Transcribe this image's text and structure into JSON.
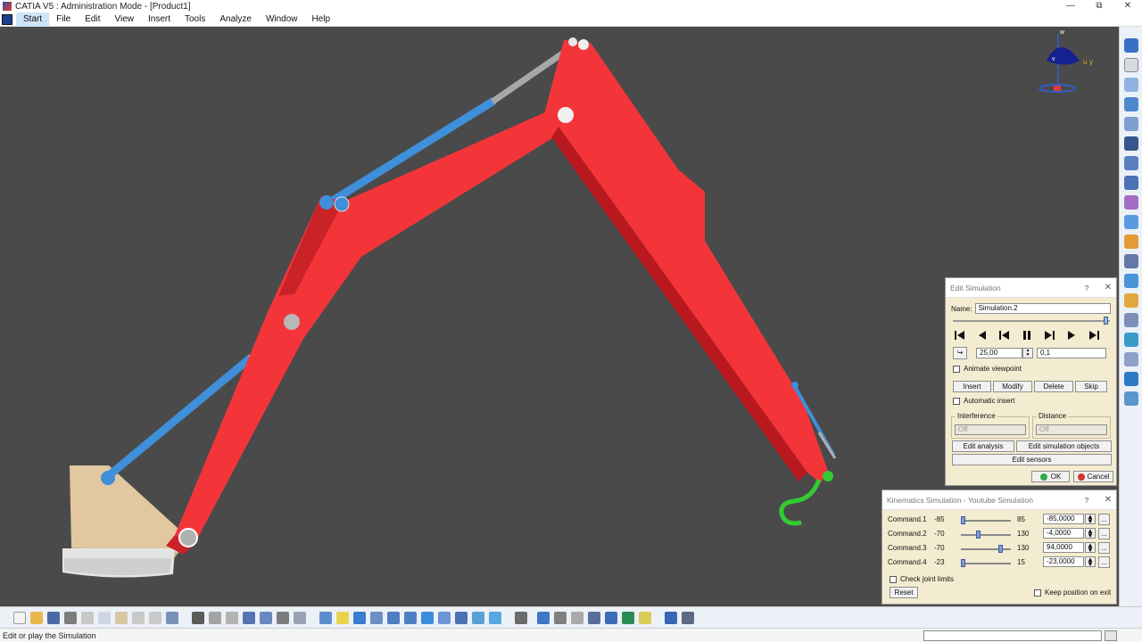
{
  "window": {
    "title": "CATIA V5 : Administration Mode - [Product1]",
    "controls": [
      "—",
      "⧉",
      "✕"
    ]
  },
  "menu": {
    "items": [
      "Start",
      "File",
      "Edit",
      "View",
      "Insert",
      "Tools",
      "Analyze",
      "Window",
      "Help"
    ]
  },
  "compass": {
    "axis_w": "w",
    "axis_u": "u",
    "axis_v": "v",
    "axis_y": "y"
  },
  "edit_simulation": {
    "title": "Edit Simulation",
    "name_label": "Name:",
    "name_value": "Simulation.2",
    "step_value": "25,00",
    "interval_value": "0,1",
    "animate_viewpoint": "Animate viewpoint",
    "buttons": {
      "insert": "Insert",
      "modify": "Modify",
      "delete": "Delete",
      "skip": "Skip"
    },
    "automatic_insert": "Automatic insert",
    "interference_label": "Interference",
    "interference_value": "Off",
    "distance_label": "Distance",
    "distance_value": "Off",
    "edit_analysis": "Edit analysis",
    "edit_simulation_objects": "Edit simulation objects",
    "edit_sensors": "Edit sensors",
    "ok": "OK",
    "cancel": "Cancel",
    "help": "?",
    "close": "✕"
  },
  "kinematics_simulation": {
    "title": "Kinematics Simulation - Youtube Simulation",
    "commands": [
      {
        "label": "Command.1",
        "min": "-85",
        "max": "85",
        "value": "-85,0000",
        "position": 0.0
      },
      {
        "label": "Command.2",
        "min": "-70",
        "max": "130",
        "value": "-4,0000",
        "position": 0.33
      },
      {
        "label": "Command.3",
        "min": "-70",
        "max": "130",
        "value": "94,0000",
        "position": 0.82
      },
      {
        "label": "Command.4",
        "min": "-23",
        "max": "15",
        "value": "-23,0000",
        "position": 0.0
      }
    ],
    "more": "...",
    "check_joint_limits": "Check joint limits",
    "reset": "Reset",
    "keep_position": "Keep position on exit",
    "help": "?",
    "close": "✕"
  },
  "status": {
    "message": "Edit or play the Simulation"
  },
  "colors": {
    "viewport": "#4a4a4a",
    "boom": "#f3353a",
    "cylinder": "#3f8fd9",
    "base": "#e1c8a0",
    "hook": "#33cc33"
  }
}
